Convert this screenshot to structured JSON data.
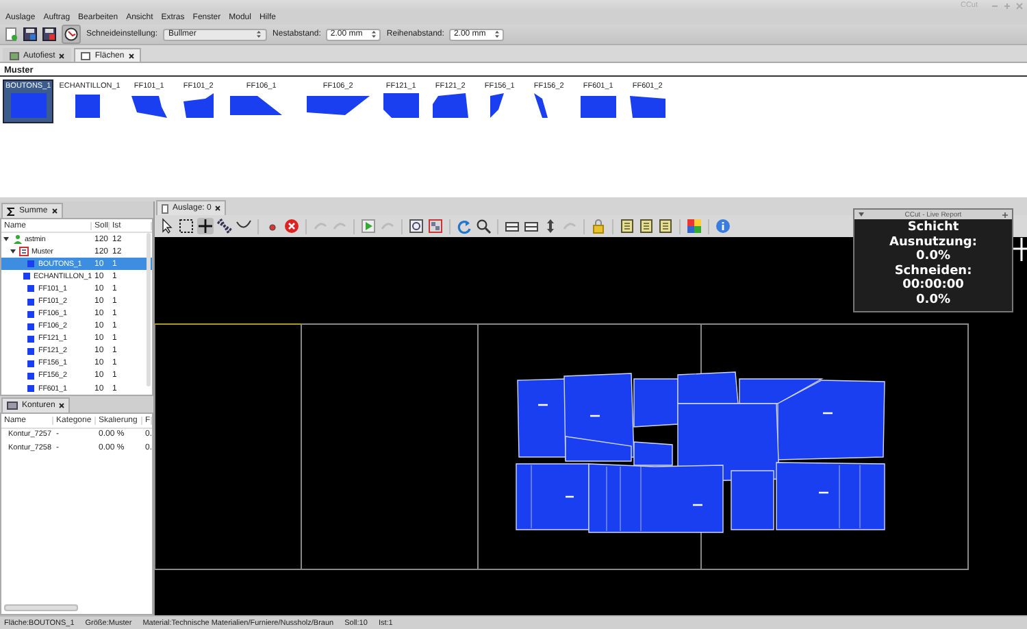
{
  "window": {
    "title": "CCut"
  },
  "menu": [
    "Auslage",
    "Auftrag",
    "Bearbeiten",
    "Ansicht",
    "Extras",
    "Fenster",
    "Modul",
    "Hilfe"
  ],
  "toolbar": {
    "cut_setting_label": "Schneideinstellung:",
    "cut_setting": "Bullmer",
    "nest_gap_label": "Nestabstand:",
    "nest_gap": "2.00 mm",
    "row_gap_label": "Reihenabstand:",
    "row_gap": "2.00 mm"
  },
  "top_tabs": [
    {
      "label": "Autofiest",
      "selected": false
    },
    {
      "label": "Flächen",
      "selected": true
    }
  ],
  "muster": {
    "title": "Muster",
    "pieces": [
      {
        "label": "BOUTONS_1",
        "selected": true
      },
      {
        "label": "ECHANTILLON_1",
        "selected": false
      },
      {
        "label": "FF101_1",
        "selected": false
      },
      {
        "label": "FF101_2",
        "selected": false
      },
      {
        "label": "FF106_1",
        "selected": false
      },
      {
        "label": "FF106_2",
        "selected": false
      },
      {
        "label": "FF121_1",
        "selected": false
      },
      {
        "label": "FF121_2",
        "selected": false
      },
      {
        "label": "FF156_1",
        "selected": false
      },
      {
        "label": "FF156_2",
        "selected": false
      },
      {
        "label": "FF601_1",
        "selected": false
      },
      {
        "label": "FF601_2",
        "selected": false
      }
    ]
  },
  "summe": {
    "tab": "Summe",
    "columns": [
      "Name",
      "Soll",
      "Ist"
    ],
    "tree": [
      {
        "name": "astmin",
        "soll": "120",
        "ist": "12",
        "kind": "user",
        "expanded": true,
        "selected": false,
        "children": [
          {
            "name": "Muster",
            "soll": "120",
            "ist": "12",
            "kind": "group",
            "expanded": true,
            "selected": false,
            "children": [
              {
                "name": "BOUTONS_1",
                "soll": "10",
                "ist": "1",
                "kind": "piece",
                "selected": true
              },
              {
                "name": "ECHANTILLON_1",
                "soll": "10",
                "ist": "1",
                "kind": "piece",
                "selected": false
              },
              {
                "name": "FF101_1",
                "soll": "10",
                "ist": "1",
                "kind": "piece",
                "selected": false
              },
              {
                "name": "FF101_2",
                "soll": "10",
                "ist": "1",
                "kind": "piece",
                "selected": false
              },
              {
                "name": "FF106_1",
                "soll": "10",
                "ist": "1",
                "kind": "piece",
                "selected": false
              },
              {
                "name": "FF106_2",
                "soll": "10",
                "ist": "1",
                "kind": "piece",
                "selected": false
              },
              {
                "name": "FF121_1",
                "soll": "10",
                "ist": "1",
                "kind": "piece",
                "selected": false
              },
              {
                "name": "FF121_2",
                "soll": "10",
                "ist": "1",
                "kind": "piece",
                "selected": false
              },
              {
                "name": "FF156_1",
                "soll": "10",
                "ist": "1",
                "kind": "piece",
                "selected": false
              },
              {
                "name": "FF156_2",
                "soll": "10",
                "ist": "1",
                "kind": "piece",
                "selected": false
              },
              {
                "name": "FF601_1",
                "soll": "10",
                "ist": "1",
                "kind": "piece",
                "selected": false
              }
            ]
          }
        ]
      }
    ]
  },
  "konturen": {
    "tab": "Konturen",
    "columns": [
      "Name",
      "Kategorie",
      "Skalierung",
      "Fl"
    ],
    "rows": [
      [
        "Kontur_7257",
        "-",
        "0.00 %",
        "0."
      ],
      [
        "Kontur_7258",
        "-",
        "0.00 %",
        "0."
      ]
    ]
  },
  "layout_tab": {
    "label": "Auslage: 0"
  },
  "live_report": {
    "title": "CCut - Live Report",
    "lines": [
      "Schicht",
      "Ausnutzung:",
      "0.0%",
      "Schneiden:",
      "00:00:00",
      "0.0%"
    ]
  },
  "status_bar": [
    "Fläche:BOUTONS_1",
    "Größe:Muster",
    "Material:Technische Materialien/Furniere/Nussholz/Braun",
    "Soll:10",
    "Ist:1"
  ]
}
